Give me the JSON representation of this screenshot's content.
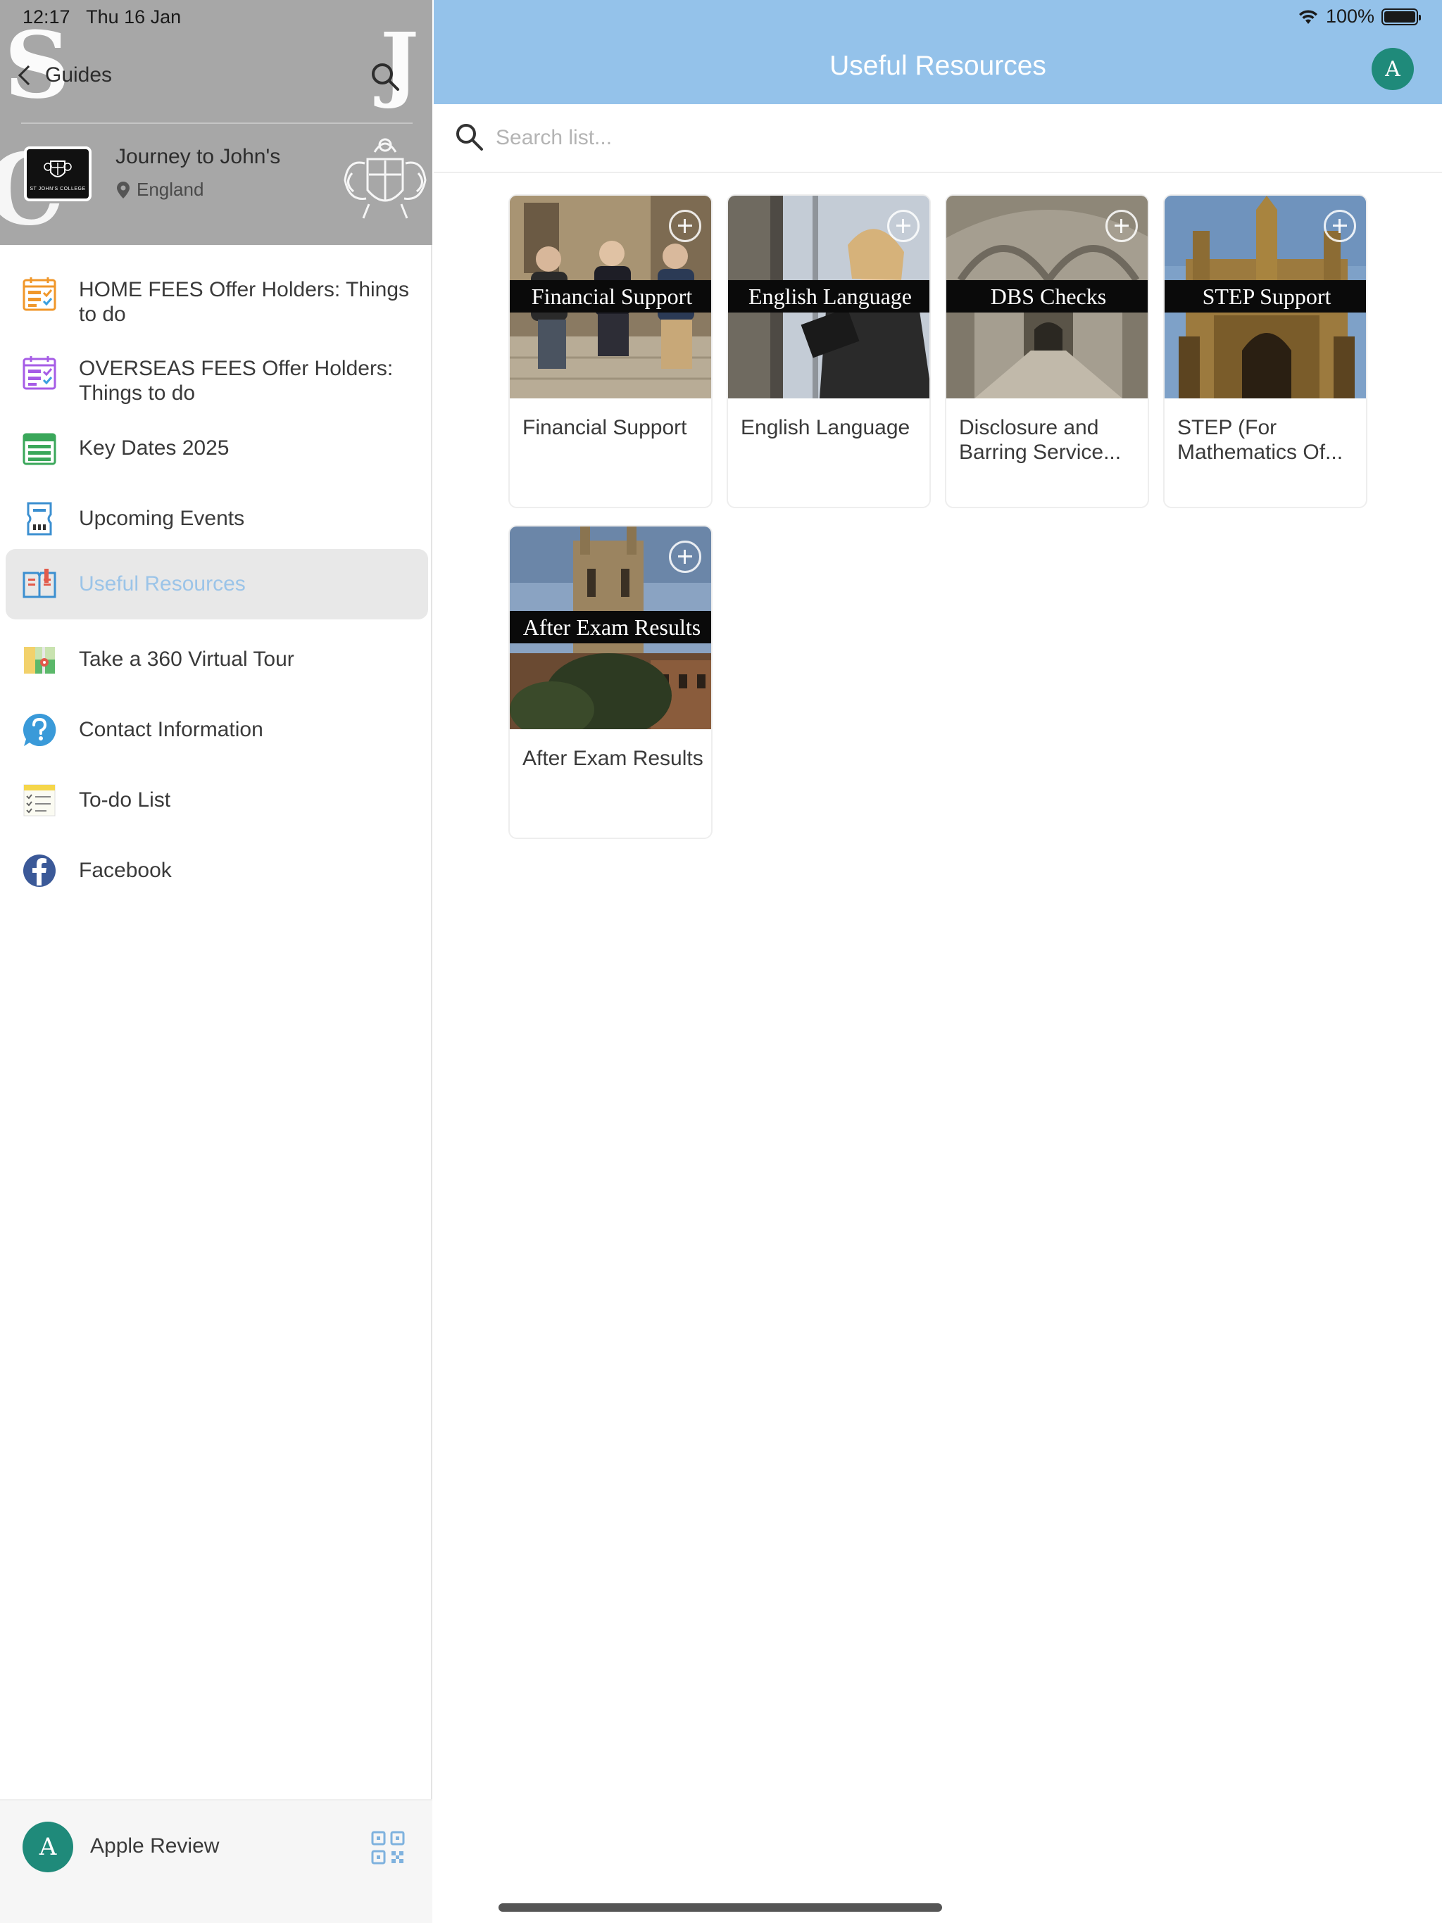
{
  "status_bar": {
    "time": "12:17",
    "date": "Thu 16 Jan",
    "battery": "100%",
    "wifi_icon": "wifi-icon",
    "battery_level": 1.0
  },
  "sidebar": {
    "back_label": "Guides",
    "guide": {
      "title": "Journey to John's",
      "location": "England",
      "logo_text": "ST JOHN'S COLLEGE"
    },
    "header_letters": [
      "S",
      "J",
      "C"
    ],
    "items": [
      {
        "label": "HOME FEES Offer Holders: Things to do",
        "icon": "checklist-calendar-icon",
        "color": "#f0972a",
        "active": false
      },
      {
        "label": "OVERSEAS FEES Offer Holders: Things to do",
        "icon": "checklist-calendar-icon",
        "color": "#a65ce6",
        "active": false
      },
      {
        "label": "Key Dates 2025",
        "icon": "calendar-list-icon",
        "color": "#3aa75a",
        "active": false
      },
      {
        "label": "Upcoming Events",
        "icon": "ticket-icon",
        "color": "#3b8fd0",
        "active": false
      },
      {
        "label": "Useful Resources",
        "icon": "book-icon",
        "color": "#e25a4a",
        "active": true
      },
      {
        "label": "Take a 360 Virtual Tour",
        "icon": "map-icon",
        "color": "#5bb86a",
        "active": false
      },
      {
        "label": "Contact Information",
        "icon": "question-icon",
        "color": "#3a9ad9",
        "active": false
      },
      {
        "label": "To-do List",
        "icon": "todo-list-icon",
        "color": "#f5d64a",
        "active": false
      },
      {
        "label": "Facebook",
        "icon": "facebook-icon",
        "color": "#3b5998",
        "active": false
      }
    ],
    "footer": {
      "avatar_letter": "A",
      "user_name": "Apple Review"
    }
  },
  "main": {
    "title": "Useful Resources",
    "avatar_letter": "A",
    "search": {
      "placeholder": "Search list..."
    },
    "cards": [
      {
        "banner": "Financial Support",
        "title": "Financial Support"
      },
      {
        "banner": "English Language",
        "title": "English Language"
      },
      {
        "banner": "DBS Checks",
        "title": "Disclosure and Barring Service..."
      },
      {
        "banner": "STEP Support",
        "title": "STEP (For Mathematics Of..."
      },
      {
        "banner": "After Exam Results",
        "title": "After Exam Results"
      }
    ]
  },
  "colors": {
    "header_blue": "#94c2ea",
    "active_label": "#9bc4e8",
    "avatar_green": "#1f8a7a",
    "sidebar_header_gray": "#a7a7a7"
  }
}
